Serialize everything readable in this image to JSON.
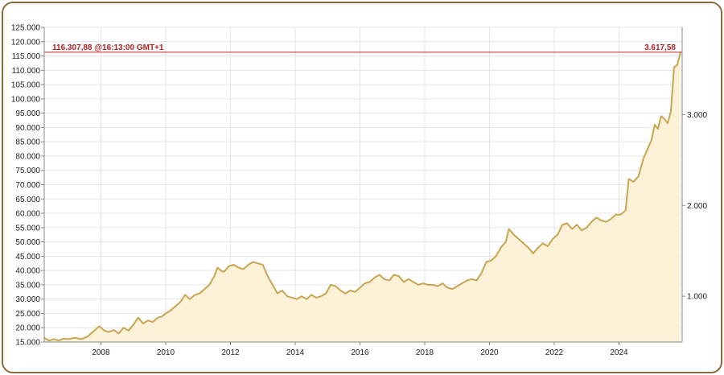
{
  "colors": {
    "line": "#c8a551",
    "area": "#fdf1d8",
    "current_line": "#cc2222",
    "current_text": "#b22222",
    "grid": "#e4e4e4",
    "frame": "#8b6a3e"
  },
  "current": {
    "left_label": "116.307,88 @16:13:00 GMT+1",
    "right_label": "3.617,58"
  },
  "chart_data": {
    "type": "area",
    "title": "",
    "xlabel": "",
    "ylabel": "",
    "xlim": [
      2006.25,
      2025.95
    ],
    "ylim": [
      15000,
      125000
    ],
    "x_ticks": [
      2008,
      2010,
      2012,
      2014,
      2016,
      2018,
      2020,
      2022,
      2024
    ],
    "x_tick_labels": [
      "2008",
      "2010",
      "2012",
      "2014",
      "2016",
      "2018",
      "2020",
      "2022",
      "2024"
    ],
    "y_ticks": [
      15000,
      20000,
      25000,
      30000,
      35000,
      40000,
      45000,
      50000,
      55000,
      60000,
      65000,
      70000,
      75000,
      80000,
      85000,
      90000,
      95000,
      100000,
      105000,
      110000,
      115000,
      120000,
      125000
    ],
    "y_tick_labels": [
      "15.000",
      "20.000",
      "25.000",
      "30.000",
      "35.000",
      "40.000",
      "45.000",
      "50.000",
      "55.000",
      "60.000",
      "65.000",
      "70.000",
      "75.000",
      "80.000",
      "85.000",
      "90.000",
      "95.000",
      "100.000",
      "105.000",
      "110.000",
      "115.000",
      "120.000",
      "125.000"
    ],
    "y2_ticks": [
      1000,
      2000,
      3000
    ],
    "y2_tick_labels": [
      "1.000",
      "2.000",
      "3.000"
    ],
    "y2_map": {
      "value_a": 1000,
      "primary_a": 31000,
      "value_b": 3000,
      "primary_b": 94500
    },
    "current_value": 116307.88,
    "grid": true,
    "series": [
      {
        "x": [
          2006.25,
          2006.4,
          2006.55,
          2006.7,
          2006.85,
          2007.0,
          2007.2,
          2007.4,
          2007.6,
          2007.8,
          2007.95,
          2008.1,
          2008.25,
          2008.4,
          2008.55,
          2008.7,
          2008.85,
          2009.0,
          2009.15,
          2009.3,
          2009.45,
          2009.6,
          2009.75,
          2009.9,
          2010.0,
          2010.15,
          2010.3,
          2010.45,
          2010.6,
          2010.75,
          2010.9,
          2011.05,
          2011.2,
          2011.35,
          2011.5,
          2011.6,
          2011.7,
          2011.8,
          2011.95,
          2012.1,
          2012.25,
          2012.4,
          2012.55,
          2012.7,
          2012.85,
          2013.0,
          2013.15,
          2013.3,
          2013.45,
          2013.6,
          2013.75,
          2013.9,
          2014.05,
          2014.2,
          2014.35,
          2014.5,
          2014.65,
          2014.8,
          2014.95,
          2015.1,
          2015.25,
          2015.4,
          2015.55,
          2015.7,
          2015.85,
          2016.0,
          2016.15,
          2016.3,
          2016.45,
          2016.6,
          2016.75,
          2016.9,
          2017.05,
          2017.2,
          2017.35,
          2017.5,
          2017.65,
          2017.8,
          2017.95,
          2018.1,
          2018.25,
          2018.4,
          2018.55,
          2018.7,
          2018.85,
          2019.0,
          2019.15,
          2019.3,
          2019.45,
          2019.6,
          2019.75,
          2019.9,
          2020.05,
          2020.2,
          2020.35,
          2020.5,
          2020.6,
          2020.75,
          2020.9,
          2021.05,
          2021.2,
          2021.35,
          2021.5,
          2021.65,
          2021.8,
          2021.95,
          2022.1,
          2022.25,
          2022.4,
          2022.55,
          2022.7,
          2022.85,
          2023.0,
          2023.15,
          2023.3,
          2023.45,
          2023.6,
          2023.75,
          2023.9,
          2024.05,
          2024.2,
          2024.3,
          2024.45,
          2024.6,
          2024.75,
          2024.9,
          2025.0,
          2025.1,
          2025.2,
          2025.3,
          2025.4,
          2025.5,
          2025.6,
          2025.7,
          2025.8,
          2025.9
        ],
        "values": [
          16500,
          15500,
          16000,
          15500,
          16200,
          16000,
          16500,
          16000,
          17000,
          19000,
          20500,
          19000,
          18500,
          19200,
          18000,
          20000,
          19000,
          21000,
          23500,
          21500,
          22500,
          22000,
          23500,
          24000,
          25000,
          26000,
          27500,
          29000,
          31500,
          30000,
          31500,
          32000,
          33500,
          35000,
          38000,
          41000,
          40000,
          39500,
          41500,
          42000,
          41000,
          40500,
          42000,
          43000,
          42500,
          42000,
          38000,
          35000,
          32000,
          33000,
          31000,
          30500,
          30000,
          31000,
          30000,
          31500,
          30500,
          31000,
          32000,
          35000,
          34500,
          33000,
          32000,
          33000,
          32500,
          34000,
          35500,
          36000,
          37500,
          38500,
          37000,
          36500,
          38500,
          38000,
          36000,
          37000,
          36000,
          35000,
          35500,
          35000,
          35000,
          34500,
          35500,
          34000,
          33500,
          34500,
          35500,
          36500,
          37000,
          36500,
          39000,
          43000,
          43500,
          45000,
          48000,
          50000,
          54500,
          52500,
          51000,
          49500,
          48000,
          46000,
          48000,
          49500,
          48500,
          51000,
          52500,
          56000,
          56500,
          54500,
          56000,
          54000,
          55000,
          57000,
          58500,
          57500,
          57000,
          58000,
          59500,
          59500,
          61000,
          72000,
          71000,
          73000,
          79000,
          83000,
          85500,
          91000,
          89500,
          94000,
          93000,
          91500,
          95500,
          111000,
          112000,
          116307.88
        ]
      }
    ]
  }
}
